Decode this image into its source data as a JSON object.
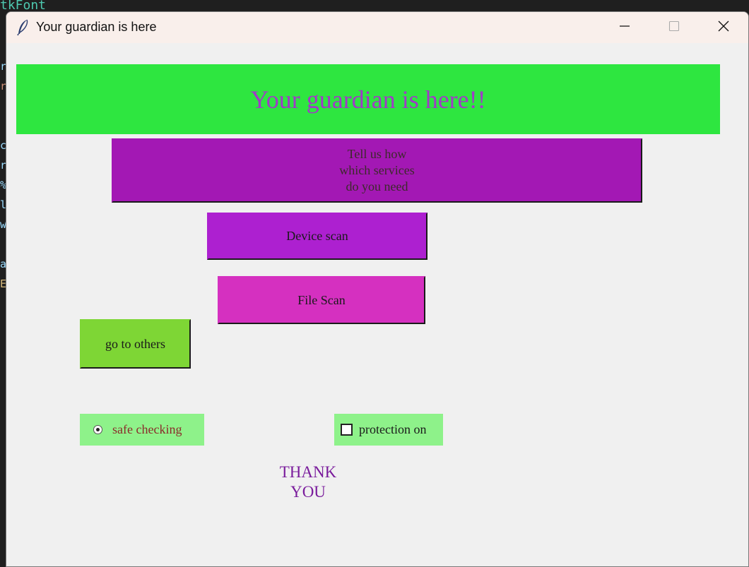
{
  "background": {
    "top_text": "tkFont",
    "gutter_chars": [
      "r",
      "",
      "r",
      "",
      "",
      "c",
      "r",
      "%",
      "l",
      "w",
      "",
      "a",
      "E"
    ]
  },
  "window": {
    "title": "Your guardian is here",
    "app_icon": "feather-icon",
    "controls": {
      "minimize": "minimize-icon",
      "maximize": "maximize-icon",
      "close": "close-icon"
    }
  },
  "content": {
    "banner_text": "Your guardian is here!!",
    "tell_button_label": "Tell us how\nwhich services\ndo you need",
    "device_scan_label": "Device scan",
    "file_scan_label": "File Scan",
    "others_label": "go to others",
    "radio_label": "safe checking",
    "radio_selected": true,
    "checkbox_label": "protection on",
    "checkbox_checked": false,
    "thanks_text": "THANK\nYOU"
  },
  "colors": {
    "banner_bg": "#2ee640",
    "banner_text": "#a03ac8",
    "tell_bg": "#a318b4",
    "device_bg": "#ad20d0",
    "file_bg": "#d530c0",
    "others_bg": "#7ed635",
    "option_bg": "#8ef28a",
    "thanks_text": "#7a1c9c"
  }
}
